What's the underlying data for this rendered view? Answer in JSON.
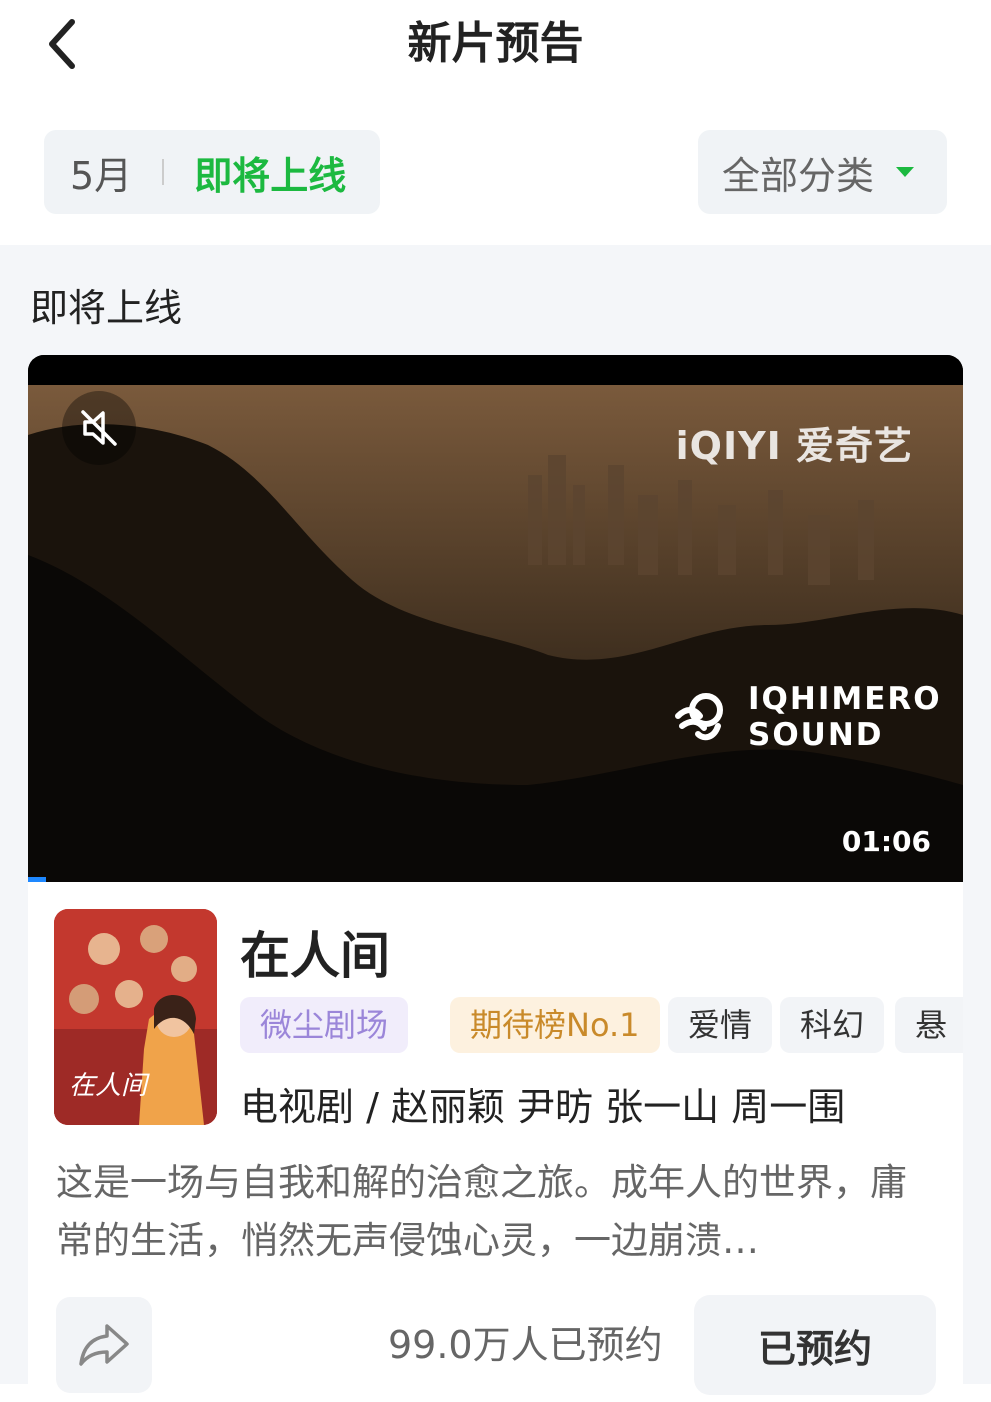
{
  "header": {
    "title": "新片预告",
    "back_icon": "chevron-left-icon"
  },
  "filters": {
    "month": "5月",
    "active_tab": "即将上线",
    "category": "全部分类",
    "accent_color": "#1cb940"
  },
  "section": {
    "title": "即将上线"
  },
  "video": {
    "mute_icon": "volume-mute-icon",
    "brand": "iQIYI 爱奇艺",
    "sound_logo_line1": "IQHIMERO",
    "sound_logo_line2": "SOUND",
    "duration": "01:06"
  },
  "show": {
    "title": "在人间",
    "poster_text": "在人间",
    "tags": [
      "微尘剧场",
      "期待榜No.1",
      "爱情",
      "科幻",
      "悬"
    ],
    "meta": "电视剧 / 赵丽颖 尹昉 张一山 周一围",
    "description": "这是一场与自我和解的治愈之旅。成年人的世界，庸常的生活，悄然无声侵蚀心灵，一边崩溃…",
    "share_icon": "share-arrow-icon",
    "reserve_count": "99.0万人已预约",
    "reserve_button": "已预约"
  }
}
